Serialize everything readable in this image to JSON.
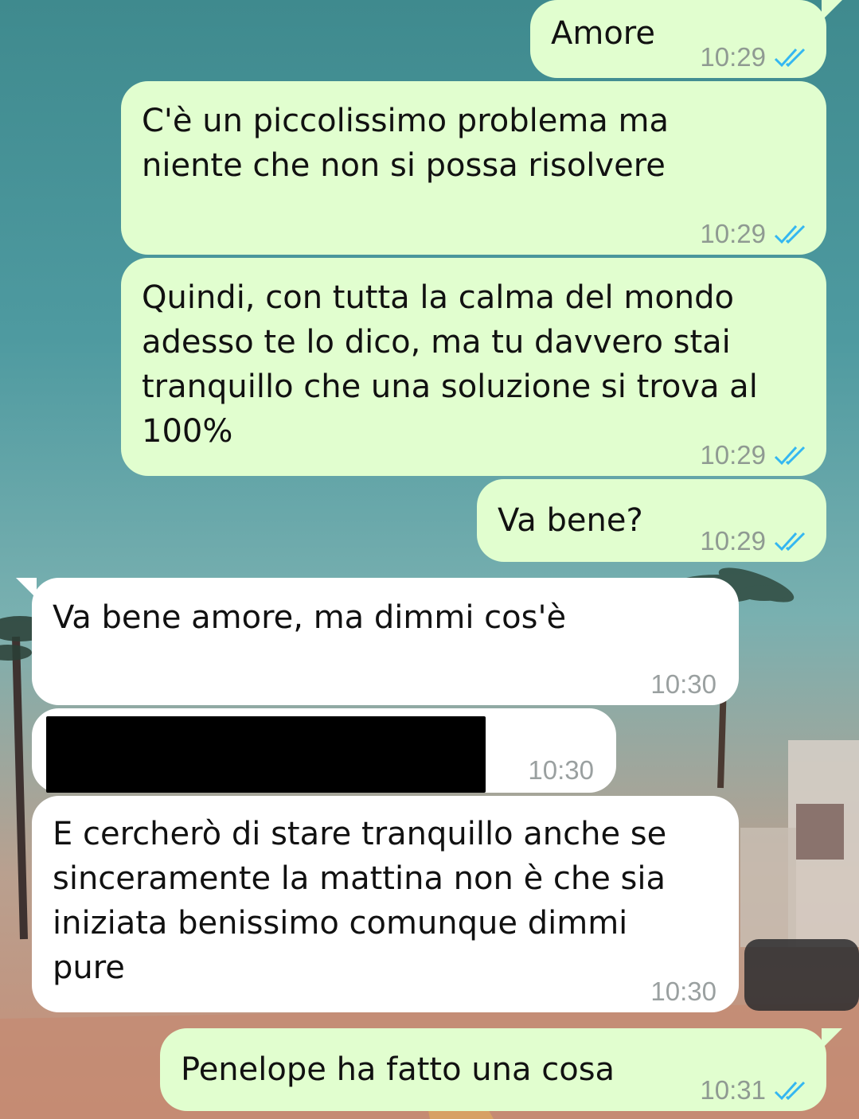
{
  "colors": {
    "outgoing_bubble": "#e1fecf",
    "incoming_bubble": "#ffffff",
    "read_ticks": "#34b7f1"
  },
  "messages": [
    {
      "direction": "out",
      "text": "Amore",
      "time": "10:29",
      "status_icon": "double-check-read-icon"
    },
    {
      "direction": "out",
      "text": "C'è un piccolissimo problema ma\nniente che non si possa risolvere",
      "time": "10:29",
      "status_icon": "double-check-read-icon"
    },
    {
      "direction": "out",
      "text": "Quindi, con tutta la calma del mondo\nadesso te lo dico, ma tu davvero stai\ntranquillo che una soluzione si trova al\n100%",
      "time": "10:29",
      "status_icon": "double-check-read-icon"
    },
    {
      "direction": "out",
      "text": "Va bene?",
      "time": "10:29",
      "status_icon": "double-check-read-icon"
    },
    {
      "direction": "in",
      "text": "Va bene amore, ma dimmi cos'è",
      "time": "10:30"
    },
    {
      "direction": "in",
      "text": "",
      "redacted": true,
      "time": "10:30"
    },
    {
      "direction": "in",
      "text": "E cercherò di stare tranquillo anche se\nsinceramente la mattina non è che sia\niniziata benissimo comunque dimmi\npure",
      "time": "10:30"
    },
    {
      "direction": "out",
      "text": "Penelope ha fatto una cosa",
      "time": "10:31",
      "status_icon": "double-check-read-icon"
    }
  ]
}
